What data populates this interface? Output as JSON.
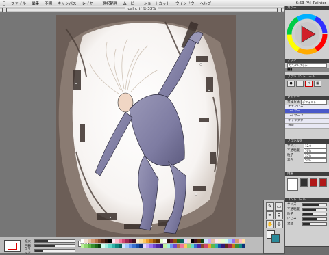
{
  "menubar": {
    "apple": "",
    "items": [
      "ファイル",
      "編集",
      "不明",
      "キャンバス",
      "レイヤー",
      "選択範囲",
      "ムービー",
      "ショートカット",
      "ウインドウ",
      "ヘルプ"
    ],
    "clock": "6:53 PM",
    "app_name": "Painter"
  },
  "document": {
    "title": "gally.rif @ 33%"
  },
  "navigator": {
    "row_labels": [
      "拡大",
      "回転",
      "グリッド"
    ],
    "values": [
      0.33,
      0.5,
      0.2
    ],
    "zoom_text": "33%"
  },
  "color_palette": {
    "swatches": [
      "#ffffff",
      "#f2e0d0",
      "#e8c0a0",
      "#d89a70",
      "#b87048",
      "#8a4a2a",
      "#5a2a18",
      "#2a1008",
      "#000000",
      "#ffe8f0",
      "#ffb8c8",
      "#f07898",
      "#d04870",
      "#a02850",
      "#701838",
      "#401020",
      "#fff0d0",
      "#ffe0a0",
      "#ffc860",
      "#f0a030",
      "#c87818",
      "#905008",
      "#603000",
      "#e8ffd0",
      "#c0f0a0",
      "#90d870",
      "#60b848",
      "#389030",
      "#1c6818",
      "#0c4010",
      "#d0fff0",
      "#a0f0e0",
      "#60d8c8",
      "#30b0a8",
      "#108880",
      "#086058",
      "#d0e8ff",
      "#a0c8ff",
      "#6898f0",
      "#3870d0",
      "#1850a8",
      "#0c3078",
      "#e8d8ff",
      "#c8a8ff",
      "#9870f0",
      "#7048d0",
      "#5028a8",
      "#301878"
    ]
  },
  "tools": [
    {
      "name": "brush-icon",
      "glyph": "✎"
    },
    {
      "name": "eraser-icon",
      "glyph": "▭"
    },
    {
      "name": "pen-icon",
      "glyph": "✒"
    },
    {
      "name": "dropper-icon",
      "glyph": "⚲"
    },
    {
      "name": "hand-icon",
      "glyph": "✋"
    },
    {
      "name": "magnifier-icon",
      "glyph": "⊕"
    }
  ],
  "panels": {
    "colors": {
      "title": "カラー"
    },
    "brush_selector": {
      "title": "ブラシ",
      "variant": "カスタムブラシ"
    },
    "brush_controls": {
      "title": "ブラシコントロール"
    },
    "layers": {
      "title": "レイヤー",
      "composite_label": "合成方法",
      "composite_value": "デフォルト",
      "items": [
        "キャンバス",
        "レイヤー 1",
        "レイヤー 2",
        "キャラクター",
        "背景"
      ],
      "selected_index": 1
    },
    "brush_props": {
      "title": "ブラシ設定",
      "rows": [
        {
          "label": "サイズ",
          "value": "12.0"
        },
        {
          "label": "不透明度",
          "value": "76%"
        },
        {
          "label": "粒子",
          "value": "35%"
        },
        {
          "label": "混合",
          "value": "50%"
        }
      ]
    },
    "paper": {
      "title": "用紙"
    },
    "sliders": {
      "title": "コントロール",
      "rows": [
        {
          "label": "サイズ",
          "level": 0.7
        },
        {
          "label": "不透明度",
          "level": 0.55
        },
        {
          "label": "粒子",
          "level": 0.4
        },
        {
          "label": "にじみ",
          "level": 0.6
        },
        {
          "label": "混合",
          "level": 0.3
        }
      ]
    }
  }
}
